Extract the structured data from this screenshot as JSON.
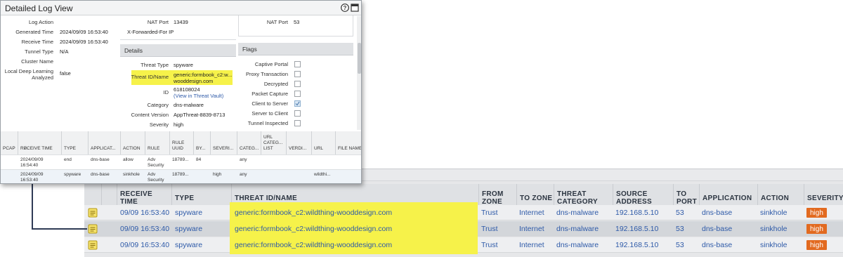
{
  "dialog": {
    "title": "Detailed Log View",
    "general": [
      {
        "label": "Log Action",
        "value": ""
      },
      {
        "label": "Generated Time",
        "value": "2024/09/09 16:53:40"
      },
      {
        "label": "Receive Time",
        "value": "2024/09/09 16:53:40"
      },
      {
        "label": "Tunnel Type",
        "value": "N/A"
      },
      {
        "label": "Cluster Name",
        "value": ""
      },
      {
        "label": "Local Deep Learning Analyzed",
        "value": "false"
      }
    ],
    "source_nat": [
      {
        "label": "NAT Port",
        "value": "13439"
      },
      {
        "label": "X-Forwarded-For IP",
        "value": ""
      }
    ],
    "dest_nat": {
      "label": "NAT Port",
      "value": "53"
    },
    "details_header": "Details",
    "details": {
      "threat_type_label": "Threat Type",
      "threat_type": "spyware",
      "threat_id_label": "Threat ID/Name",
      "threat_id": "generic:formbook_c2:w... wooddesign.com",
      "id_label": "ID",
      "id_value": "618108024",
      "id_link": "(View in Threat Vault)",
      "category_label": "Category",
      "category": "dns-malware",
      "content_version_label": "Content Version",
      "content_version": "AppThreat-8839-8713",
      "severity_label": "Severity",
      "severity": "high"
    },
    "flags_header": "Flags",
    "flags": [
      {
        "label": "Captive Portal",
        "checked": false
      },
      {
        "label": "Proxy Transaction",
        "checked": false
      },
      {
        "label": "Decrypted",
        "checked": false
      },
      {
        "label": "Packet Capture",
        "checked": false
      },
      {
        "label": "Client to Server",
        "checked": true
      },
      {
        "label": "Server to Client",
        "checked": false
      },
      {
        "label": "Tunnel Inspected",
        "checked": false
      }
    ],
    "mini_table": {
      "headers": [
        "PCAP",
        "RECEIVE TIME",
        "TYPE",
        "APPLICAT...",
        "ACTION",
        "RULE",
        "RULE UUID",
        "BY...",
        "SEVERI...",
        "CATEG...",
        "URL CATEG... LIST",
        "VERDI...",
        "URL",
        "FILE NAME"
      ],
      "rows": [
        {
          "time": "2024/09/09 16:54:40",
          "type": "end",
          "app": "dns-base",
          "action": "allow",
          "rule": "Adv Security",
          "uuid": "18789...",
          "bytes": "84",
          "severity": "",
          "category": "any",
          "url": ""
        },
        {
          "time": "2024/09/09 16:53:40",
          "type": "spyware",
          "app": "dns-base",
          "action": "sinkhole",
          "rule": "Adv Security",
          "uuid": "18789...",
          "bytes": "",
          "severity": "high",
          "category": "any",
          "url": "wildthi..."
        }
      ]
    }
  },
  "log_table": {
    "headers": {
      "receive_time": "RECEIVE TIME",
      "type": "TYPE",
      "threat": "THREAT ID/NAME",
      "from_zone": "FROM ZONE",
      "to_zone": "TO ZONE",
      "threat_category": "THREAT CATEGORY",
      "source_address": "SOURCE ADDRESS",
      "to_port": "TO PORT",
      "application": "APPLICATION",
      "action": "ACTION",
      "severity": "SEVERITY"
    },
    "rows": [
      {
        "receive_time": "09/09 16:53:40",
        "type": "spyware",
        "threat": "generic:formbook_c2:wildthing-wooddesign.com",
        "from_zone": "Trust",
        "to_zone": "Internet",
        "category": "dns-malware",
        "source": "192.168.5.10",
        "port": "53",
        "application": "dns-base",
        "action": "sinkhole",
        "severity": "high"
      },
      {
        "receive_time": "09/09 16:53:40",
        "type": "spyware",
        "threat": "generic:formbook_c2:wildthing-wooddesign.com",
        "from_zone": "Trust",
        "to_zone": "Internet",
        "category": "dns-malware",
        "source": "192.168.5.10",
        "port": "53",
        "application": "dns-base",
        "action": "sinkhole",
        "severity": "high"
      },
      {
        "receive_time": "09/09 16:53:40",
        "type": "spyware",
        "threat": "generic:formbook_c2:wildthing-wooddesign.com",
        "from_zone": "Trust",
        "to_zone": "Internet",
        "category": "dns-malware",
        "source": "192.168.5.10",
        "port": "53",
        "application": "dns-base",
        "action": "sinkhole",
        "severity": "high"
      }
    ]
  },
  "colors": {
    "highlight": "#f6f24a",
    "severity_high": "#e26a20",
    "link": "#2e5aa8"
  }
}
